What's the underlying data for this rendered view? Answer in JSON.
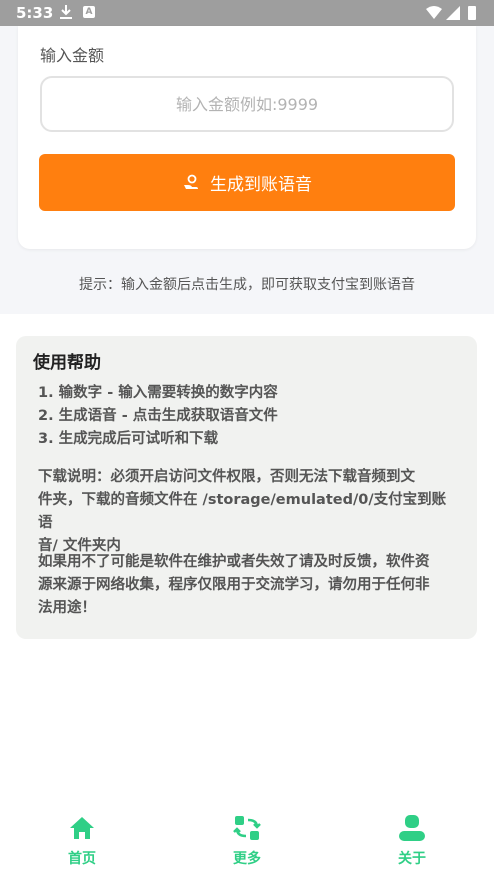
{
  "status": {
    "time": "5:33",
    "a_badge": "A"
  },
  "form": {
    "label": "输入金额",
    "placeholder": "输入金额例如:9999",
    "button_label": "生成到账语音"
  },
  "tip": "提示：输入金额后点击生成，即可获取支付宝到账语音",
  "help": {
    "title": "使用帮助",
    "steps": [
      "1. 输数字 - 输入需要转换的数字内容",
      "2. 生成语音 - 点击生成获取语音文件",
      "3. 生成完成后可试听和下载"
    ],
    "download_note_lines": [
      "下载说明：必须开启访问文件权限，否则无法下载音频到文",
      "件夹，下载的音频文件在 /storage/emulated/0/支付宝到账语",
      "音/ 文件夹内"
    ],
    "disclaimer_lines": [
      "如果用不了可能是软件在维护或者失效了请及时反馈，软件资",
      "源来源于网络收集，程序仅限用于交流学习，请勿用于任何非",
      "法用途！"
    ]
  },
  "nav": {
    "home_label": "首页",
    "more_label": "更多",
    "about_label": "关于",
    "accent": "#2fcf86"
  },
  "colors": {
    "button": "#ff7f0f",
    "nav_accent": "#2fcf86"
  }
}
